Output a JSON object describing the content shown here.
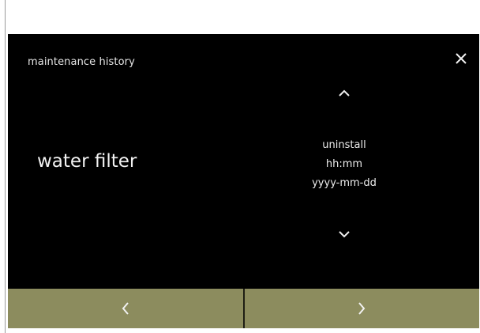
{
  "header": {
    "title": "maintenance history",
    "close_icon": "close-icon"
  },
  "item": {
    "label": "water filter"
  },
  "values": {
    "action": "uninstall",
    "time": "hh:mm",
    "date": "yyyy-mm-dd"
  },
  "scroll": {
    "up_icon": "chevron-up-icon",
    "down_icon": "chevron-down-icon"
  },
  "footer": {
    "prev_icon": "chevron-left-icon",
    "next_icon": "chevron-right-icon"
  },
  "colors": {
    "screen_background": "#000000",
    "footer_button": "#8c8c5e",
    "text": "#ececec"
  }
}
